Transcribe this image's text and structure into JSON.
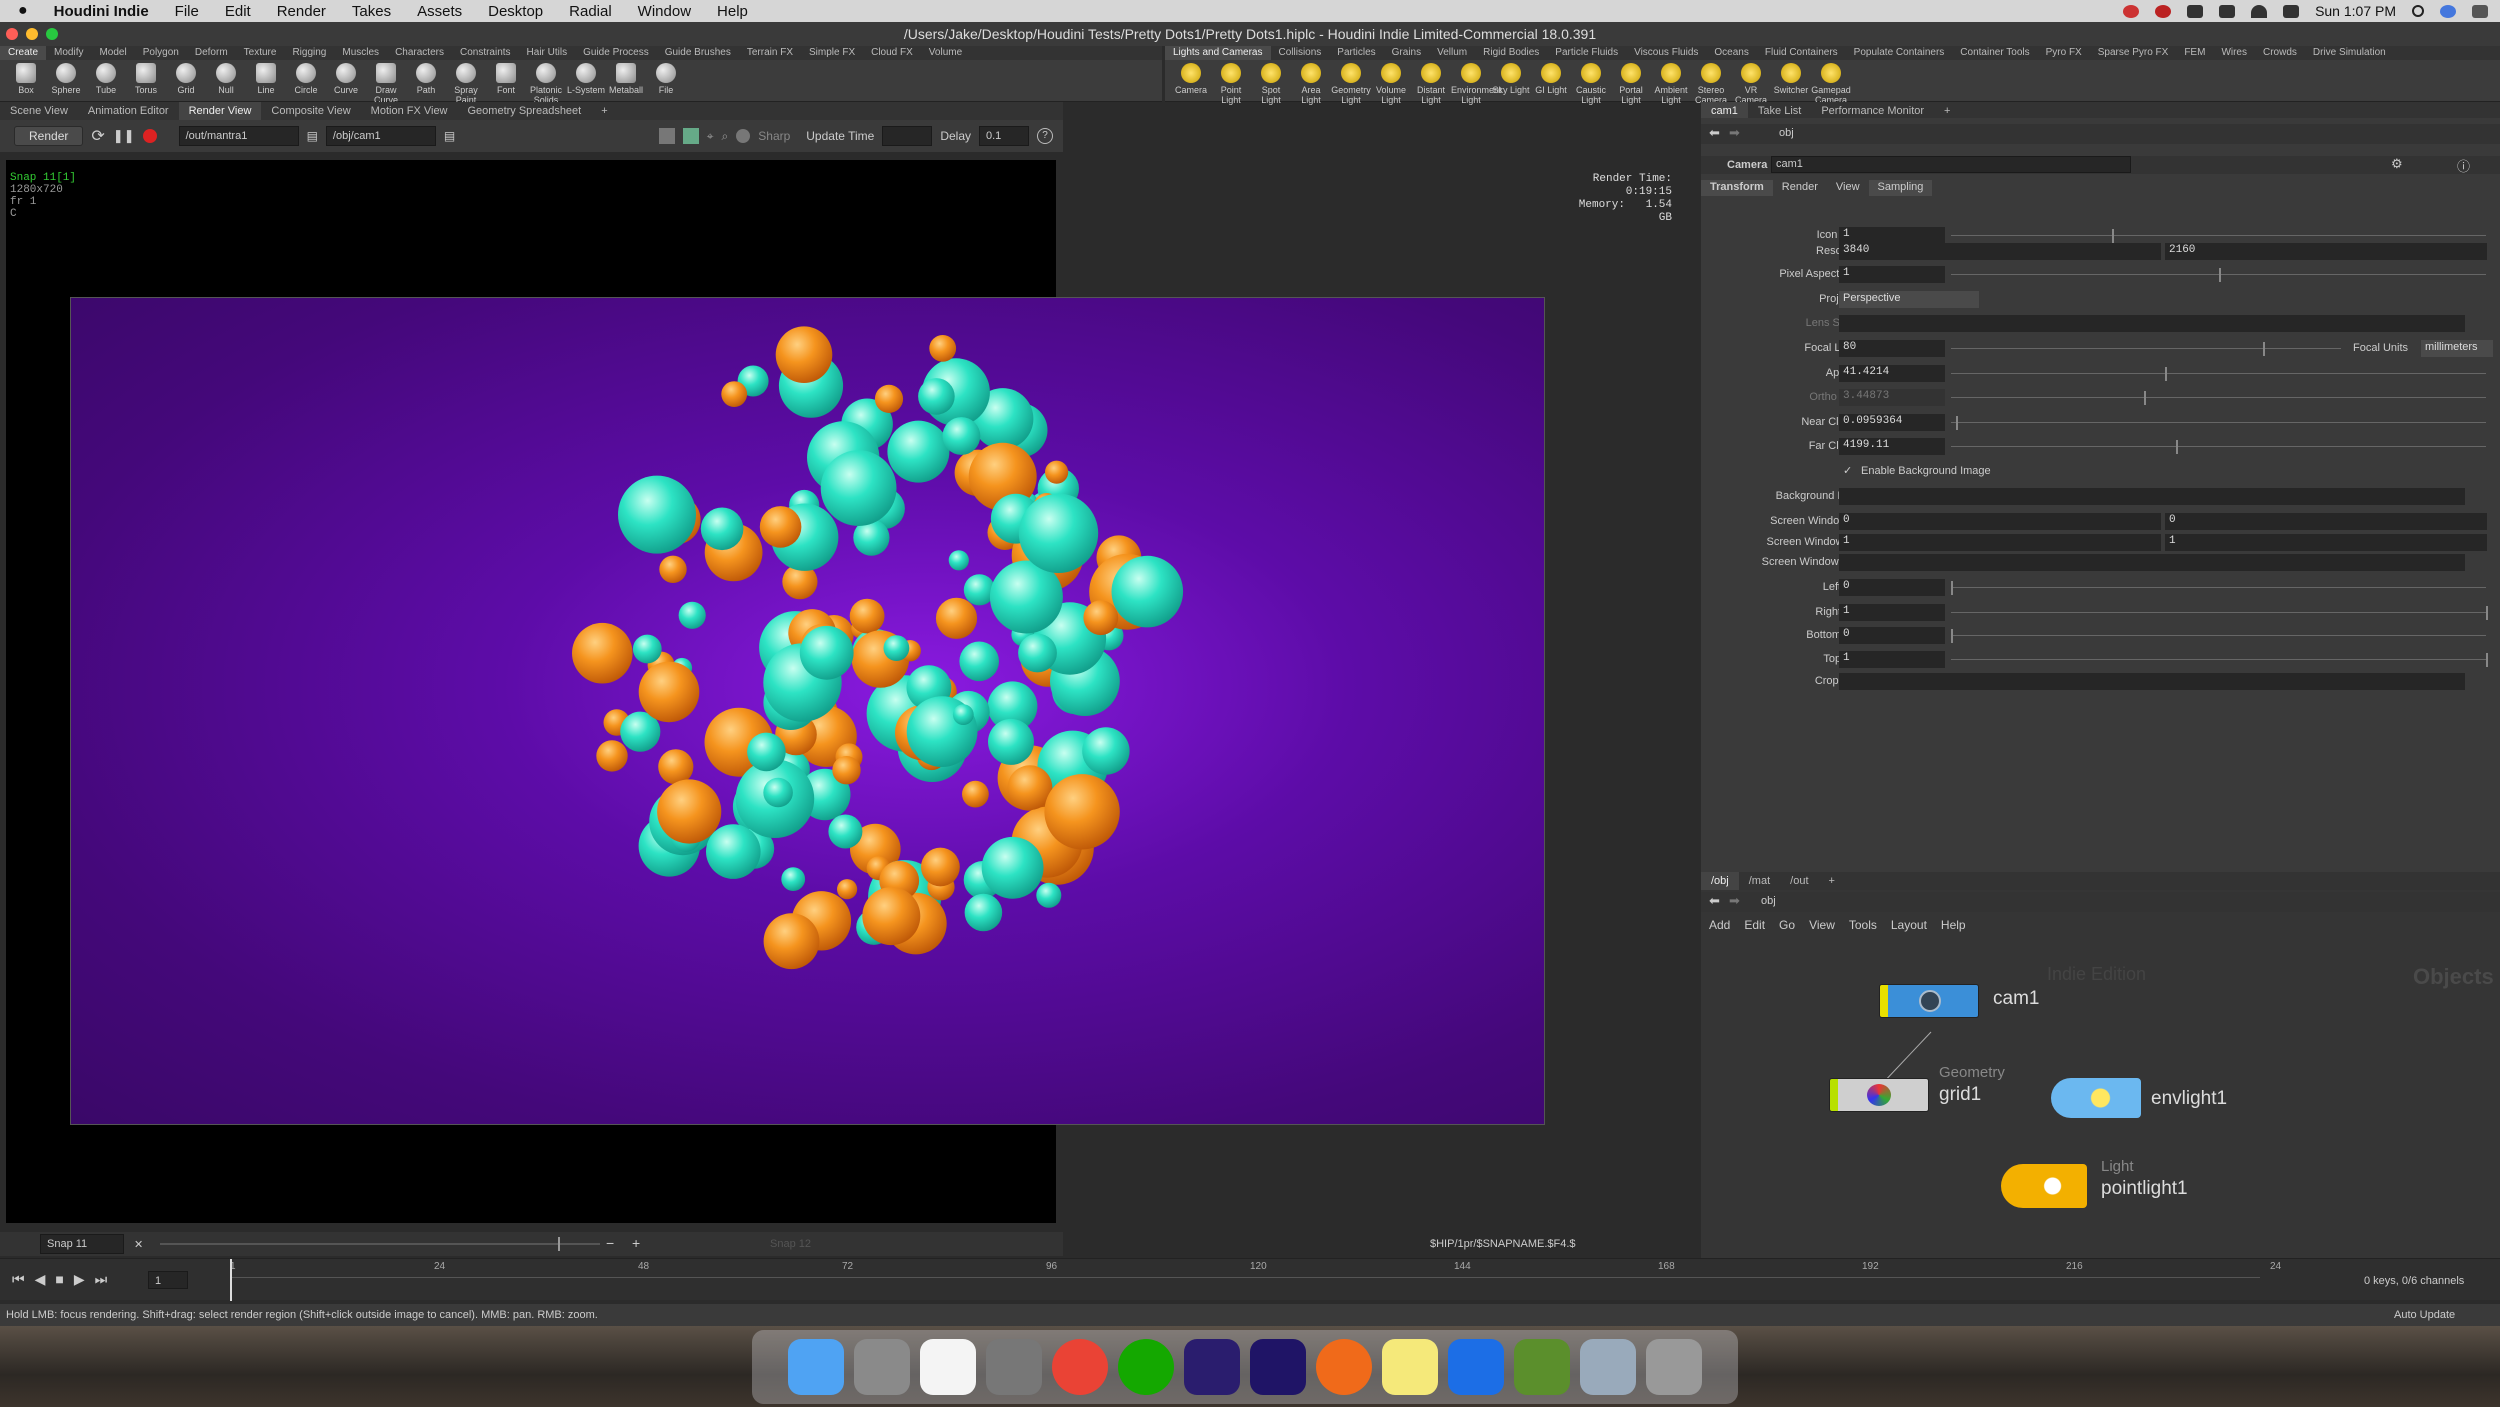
{
  "menubar": {
    "apple": "",
    "app": "Houdini Indie",
    "items": [
      "File",
      "Edit",
      "Render",
      "Takes",
      "Assets",
      "Desktop",
      "Radial",
      "Window",
      "Help"
    ],
    "clock": "Sun 1:07 PM"
  },
  "window": {
    "title": "/Users/Jake/Desktop/Houdini Tests/Pretty Dots1/Pretty Dots1.hiplc - Houdini Indie Limited-Commercial 18.0.391"
  },
  "shelf_left": {
    "tabs": [
      "Create",
      "Modify",
      "Model",
      "Polygon",
      "Deform",
      "Texture",
      "Rigging",
      "Muscles",
      "Characters",
      "Constraints",
      "Hair Utils",
      "Guide Process",
      "Guide Brushes",
      "Terrain FX",
      "Simple FX",
      "Cloud FX",
      "Volume"
    ],
    "tools": [
      "Box",
      "Sphere",
      "Tube",
      "Torus",
      "Grid",
      "Null",
      "Line",
      "Circle",
      "Curve",
      "Draw Curve",
      "Path",
      "Spray Paint",
      "Font",
      "Platonic Solids",
      "L-System",
      "Metaball",
      "File"
    ]
  },
  "shelf_right": {
    "tabs": [
      "Lights and Cameras",
      "Collisions",
      "Particles",
      "Grains",
      "Vellum",
      "Rigid Bodies",
      "Particle Fluids",
      "Viscous Fluids",
      "Oceans",
      "Fluid Containers",
      "Populate Containers",
      "Container Tools",
      "Pyro FX",
      "Sparse Pyro FX",
      "FEM",
      "Wires",
      "Crowds",
      "Drive Simulation"
    ],
    "tools": [
      "Camera",
      "Point Light",
      "Spot Light",
      "Area Light",
      "Geometry Light",
      "Volume Light",
      "Distant Light",
      "Environment Light",
      "Sky Light",
      "GI Light",
      "Caustic Light",
      "Portal Light",
      "Ambient Light",
      "Stereo Camera",
      "VR Camera",
      "Switcher",
      "Gamepad Camera"
    ]
  },
  "left_tabs": [
    "Scene View",
    "Animation Editor",
    "Render View",
    "Composite View",
    "Motion FX View",
    "Geometry Spreadsheet"
  ],
  "render_toolbar": {
    "render_label": "Render",
    "output": "/out/mantra1",
    "camera": "/obj/cam1",
    "sharp": "Sharp",
    "update_time": "Update Time",
    "delay_label": "Delay",
    "delay": "0.1"
  },
  "viewer": {
    "snap": "Snap 11[1]",
    "res": "1280x720",
    "frame": "fr 1",
    "channel": "C",
    "render_time": "Render Time: 0:19:15",
    "memory_label": "Memory:",
    "memory": "1.54 GB"
  },
  "snapbar": {
    "snap": "Snap 11",
    "snap2": "Snap 12",
    "path": "$HIP/1pr/$SNAPNAME.$F4.$"
  },
  "right_tabs": [
    "cam1",
    "Take List",
    "Performance Monitor"
  ],
  "parm": {
    "path": "obj",
    "node_type": "Camera",
    "node_name": "cam1",
    "tabs": [
      "Transform",
      "Render",
      "View",
      "Sampling"
    ],
    "rows": [
      {
        "label": "Icon Scale",
        "v1": "1",
        "frac": 0.3
      },
      {
        "label": "Resolution",
        "v1": "3840",
        "v2": "2160"
      },
      {
        "label": "Pixel Aspect Ratio",
        "v1": "1",
        "frac": 0.5
      },
      {
        "label": "Projection",
        "v1": "Perspective"
      },
      {
        "label": "Lens Shader",
        "v1": ""
      },
      {
        "label": "Focal Length",
        "v1": "80",
        "frac": 0.8,
        "extra_label": "Focal Units",
        "extra": "millimeters"
      },
      {
        "label": "Aperture",
        "v1": "41.4214",
        "frac": 0.4
      },
      {
        "label": "Ortho Width",
        "v1": "3.44873",
        "frac": 0.36
      },
      {
        "label": "Near Clipping",
        "v1": "0.0959364",
        "frac": 0.01
      },
      {
        "label": "Far Clipping",
        "v1": "4199.11",
        "frac": 0.42
      },
      {
        "label": "Enable Background Image",
        "v1": ""
      },
      {
        "label": "Background Image",
        "v1": ""
      },
      {
        "label": "Screen Window X/Y",
        "v1": "0",
        "v2": "0"
      },
      {
        "label": "Screen Window Size",
        "v1": "1",
        "v2": "1"
      },
      {
        "label": "Screen Window Mask",
        "v1": ""
      },
      {
        "label": "Left Crop",
        "v1": "0",
        "frac": 0
      },
      {
        "label": "Right Crop",
        "v1": "1",
        "frac": 1
      },
      {
        "label": "Bottom Crop",
        "v1": "0",
        "frac": 0
      },
      {
        "label": "Top Crop",
        "v1": "1",
        "frac": 1
      },
      {
        "label": "Crop Mask",
        "v1": ""
      }
    ]
  },
  "network": {
    "tabs": [
      "/obj",
      "/mat",
      "/out"
    ],
    "path": "obj",
    "menu": [
      "Add",
      "Edit",
      "Go",
      "View",
      "Tools",
      "Layout",
      "Help"
    ],
    "watermark": "Indie Edition",
    "context": "Objects",
    "nodes": [
      {
        "name": "cam1",
        "type": ""
      },
      {
        "name": "grid1",
        "type": "Geometry"
      },
      {
        "name": "envlight1",
        "type": ""
      },
      {
        "name": "pointlight1",
        "type": "Light"
      }
    ]
  },
  "timeline": {
    "frame": "1",
    "ticks": [
      "1",
      "24",
      "48",
      "72",
      "96",
      "120",
      "144",
      "168",
      "192",
      "216",
      "24"
    ],
    "keys": "0 keys, 0/6 channels",
    "auto_update": "Auto Update"
  },
  "status": "Hold LMB: focus rendering. Shift+drag: select render region (Shift+click outside image to cancel). MMB: pan. RMB: zoom.",
  "dock": [
    "Finder",
    "Launchpad",
    "Calendar",
    "System Preferences",
    "Chrome",
    "Upwork",
    "Premiere",
    "After Effects",
    "Houdini",
    "Notes",
    "QuickTime",
    "Minecraft",
    "Preview",
    "Trash"
  ],
  "colors": {
    "orange": "#f5941e",
    "teal": "#2de3c4",
    "bg": "#5d0ca8"
  }
}
